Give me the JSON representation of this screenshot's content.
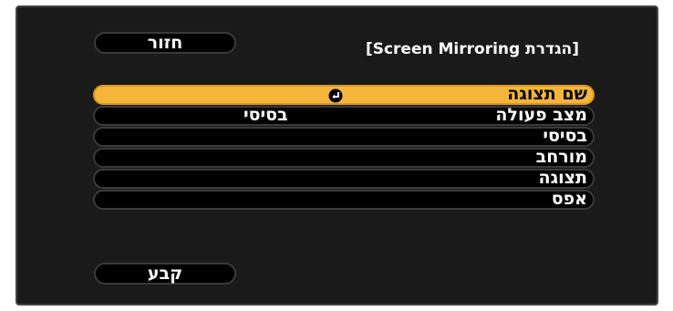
{
  "header": {
    "back_label": "חזור",
    "title": "[הגדרת Screen Mirroring]"
  },
  "menu": {
    "items": [
      {
        "label": "שם תצוגה",
        "value": "",
        "selected": true,
        "icon": "enter-icon"
      },
      {
        "label": "מצב פעולה",
        "value": "בסיסי",
        "selected": false
      },
      {
        "label": "בסיסי",
        "value": "",
        "selected": false
      },
      {
        "label": "מורחב",
        "value": "",
        "selected": false
      },
      {
        "label": "תצוגה",
        "value": "",
        "selected": false
      },
      {
        "label": "אפס",
        "value": "",
        "selected": false
      }
    ]
  },
  "footer": {
    "set_label": "קבע"
  },
  "colors": {
    "highlight": "#f5b53b",
    "panel": "#1a1a1a"
  }
}
